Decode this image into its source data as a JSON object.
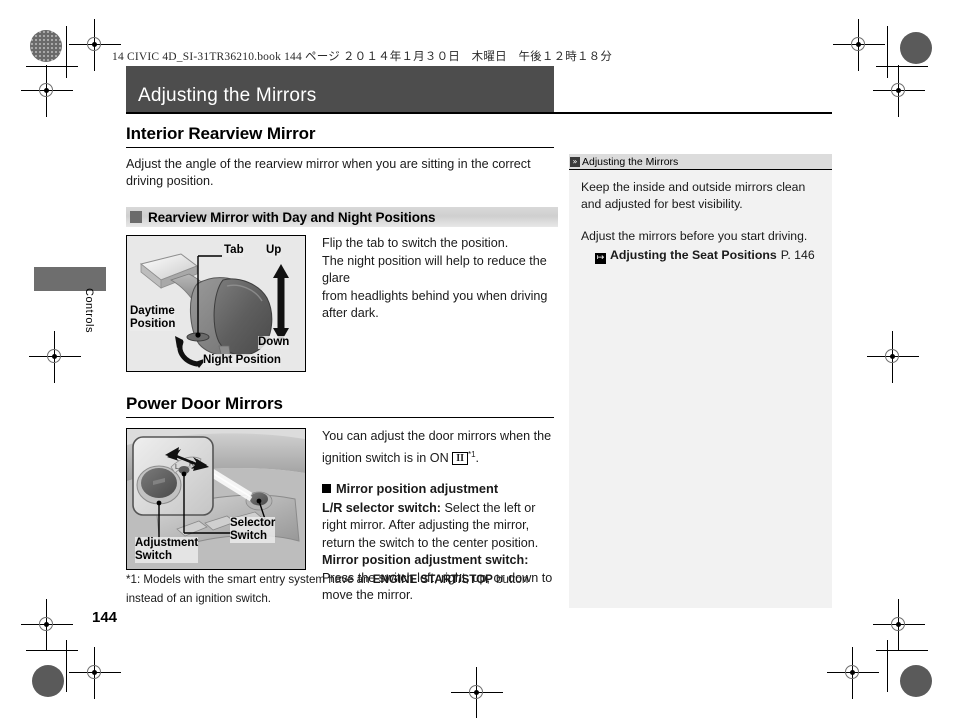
{
  "meta": {
    "slugline": "14 CIVIC 4D_SI-31TR36210.book    144 ページ    ２０１４年１月３０日　木曜日　午後１２時１８分",
    "page_number": "144",
    "chapter_tab_label": "Controls",
    "accent_dark": "#4d4d4d",
    "sidebar_bg": "#f2f2f2",
    "subhead_bg": "#d4d4d4"
  },
  "title_bar": {
    "title": "Adjusting the Mirrors"
  },
  "sections": {
    "interior": {
      "heading": "Interior Rearview Mirror",
      "intro": "Adjust the angle of the rearview mirror when you are sitting in the correct driving position.",
      "subhead": "Rearview Mirror with Day and Night Positions",
      "body_lines": [
        "Flip the tab to switch the position.",
        "The night position will help to reduce the glare",
        "from headlights behind you when driving",
        "after dark."
      ],
      "figure_labels": {
        "tab": "Tab",
        "up": "Up",
        "down": "Down",
        "daytime": "Daytime\nPosition",
        "night": "Night Position"
      }
    },
    "power_door": {
      "heading": "Power Door Mirrors",
      "intro_line1": "You can adjust the door mirrors when the",
      "intro_line2_before": "ignition switch is in ON ",
      "on_symbol": "II",
      "intro_footnote_marker": "*1",
      "intro_line2_after": ".",
      "inline_head": "Mirror position adjustment",
      "paragraph1_bold": "L/R selector switch:",
      "paragraph1_rest": " Select the left or right mirror. After adjusting the mirror, return the switch to the center position.",
      "paragraph2_bold": "Mirror position adjustment switch:",
      "paragraph2_rest": " Press the switch left, right, up, or down to move the mirror.",
      "figure_labels": {
        "adjustment": "Adjustment\nSwitch",
        "selector": "Selector\nSwitch"
      }
    }
  },
  "footnote": {
    "prefix": "*1: Models with the smart entry system have an ",
    "bold": "ENGINE START/STOP",
    "suffix": " button instead of an ignition switch."
  },
  "sidebar": {
    "header_icon": "»",
    "header_title": "Adjusting the Mirrors",
    "paragraph1": "Keep the inside and outside mirrors clean and adjusted for best visibility.",
    "paragraph2": "Adjust the mirrors before you start driving.",
    "xref_icon": "↦",
    "xref_label": "Adjusting the Seat Positions",
    "xref_page": "P. 146"
  }
}
